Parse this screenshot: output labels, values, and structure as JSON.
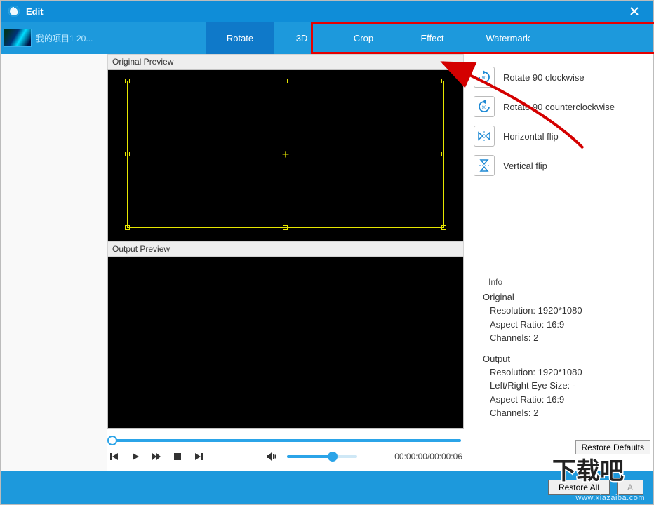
{
  "titlebar": {
    "title": "Edit"
  },
  "sidebar": {
    "item_label": "我的项目1 20..."
  },
  "tabs": {
    "rotate": "Rotate",
    "threeD": "3D",
    "crop": "Crop",
    "effect": "Effect",
    "watermark": "Watermark"
  },
  "preview": {
    "original_label": "Original Preview",
    "output_label": "Output Preview"
  },
  "player": {
    "time": "00:00:00/00:00:06"
  },
  "rotate_panel": {
    "cw": "Rotate 90 clockwise",
    "ccw": "Rotate 90 counterclockwise",
    "hflip": "Horizontal flip",
    "vflip": "Vertical flip"
  },
  "info": {
    "legend": "Info",
    "original": {
      "title": "Original",
      "resolution_label": "Resolution:",
      "resolution_value": "1920*1080",
      "aspect_label": "Aspect Ratio:",
      "aspect_value": "16:9",
      "channels_label": "Channels:",
      "channels_value": "2"
    },
    "output": {
      "title": "Output",
      "resolution_label": "Resolution:",
      "resolution_value": "1920*1080",
      "lre_label": "Left/Right Eye Size:",
      "lre_value": "-",
      "aspect_label": "Aspect Ratio:",
      "aspect_value": "16:9",
      "channels_label": "Channels:",
      "channels_value": "2"
    },
    "restore_defaults": "Restore Defaults"
  },
  "footer": {
    "restore_all": "Restore All",
    "apply_all": "A",
    "site": "www.xiazaiba.com"
  }
}
